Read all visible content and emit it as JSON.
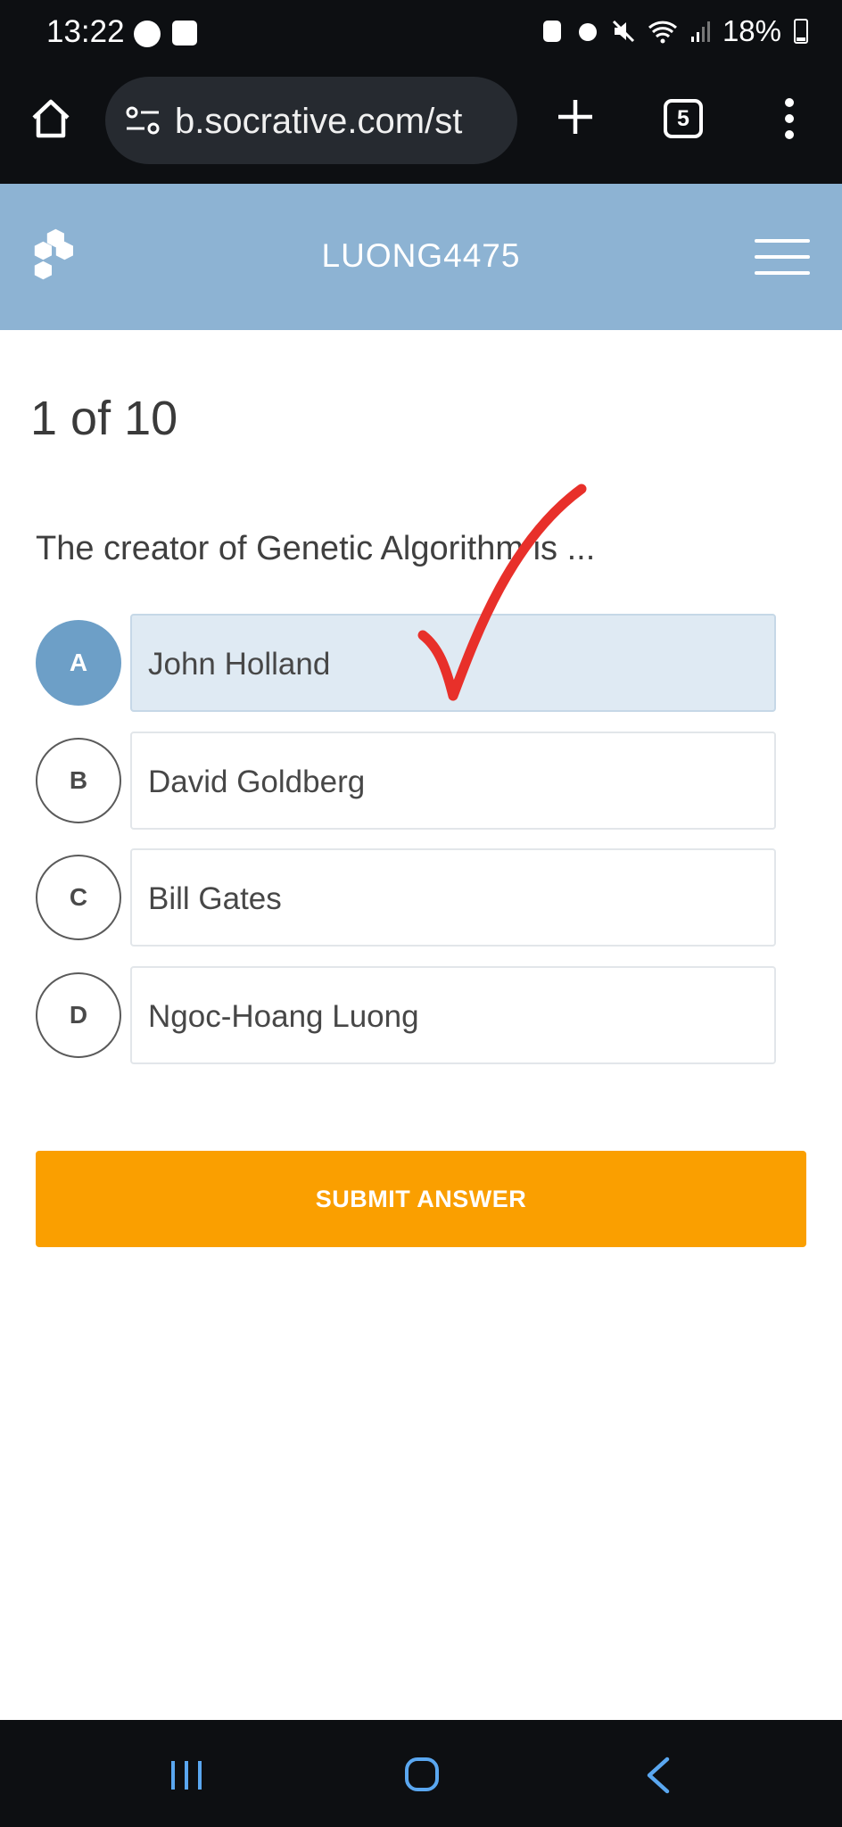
{
  "status_bar": {
    "time": "13:22",
    "battery": "18%",
    "icons": [
      "messenger-icon",
      "checkbox-notification-icon",
      "battery-saver-icon",
      "alarm-icon",
      "mute-icon",
      "wifi-icon",
      "signal-icon",
      "battery-icon"
    ]
  },
  "browser": {
    "url": "b.socrative.com/st",
    "tab_count": "5"
  },
  "header": {
    "room_name": "LUONG4475"
  },
  "quiz": {
    "progress": "1 of 10",
    "question": "The creator of Genetic Algorithm is ...",
    "answers": [
      {
        "letter": "A",
        "text": "John Holland",
        "selected": true
      },
      {
        "letter": "B",
        "text": "David Goldberg",
        "selected": false
      },
      {
        "letter": "C",
        "text": "Bill Gates",
        "selected": false
      },
      {
        "letter": "D",
        "text": "Ngoc-Hoang Luong",
        "selected": false
      }
    ],
    "submit_label": "SUBMIT ANSWER"
  },
  "colors": {
    "header_bg": "#8db3d3",
    "selected_letter": "#6d9fc7",
    "selected_box": "#dfeaf3",
    "submit_bg": "#fa9f00",
    "annotation_check": "#e8302a"
  }
}
